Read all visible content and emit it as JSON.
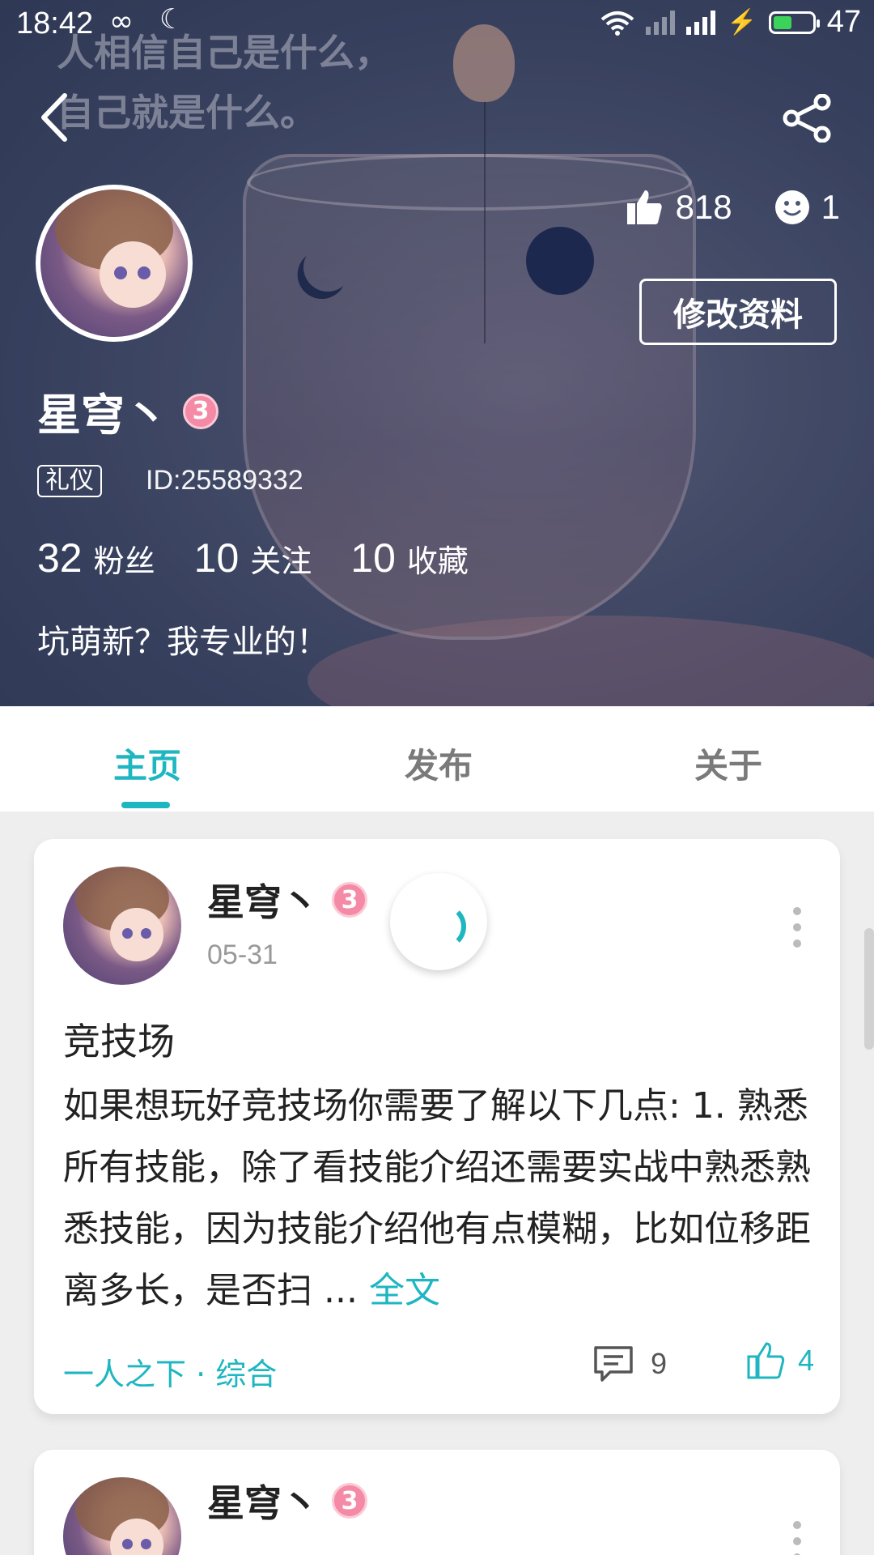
{
  "status_bar": {
    "time": "18:42",
    "battery": "47",
    "battery_level": 0.47
  },
  "cover": {
    "quote_line1": "人相信自己是什么，",
    "quote_line2": "自己就是什么。",
    "likes": "818",
    "visitors": "1",
    "edit_button": "修改资料",
    "nickname": "星穹丶",
    "level": "3",
    "tag": "礼仪",
    "user_id": "ID:25589332",
    "followers_count": "32",
    "followers_label": "粉丝",
    "following_count": "10",
    "following_label": "关注",
    "favorites_count": "10",
    "favorites_label": "收藏",
    "bio": "坑萌新？我专业的！"
  },
  "tabs": {
    "home": "主页",
    "publish": "发布",
    "about": "关于",
    "active": "home"
  },
  "posts": [
    {
      "author": "星穹丶",
      "level": "3",
      "date": "05-31",
      "title": "竞技场",
      "body": "如果想玩好竞技场你需要了解以下几点: 1. 熟悉所有技能，除了看技能介绍还需要实战中熟悉熟悉技能，因为技能介绍他有点模糊，比如位移距离多长，是否扫 ...",
      "full_text_link": "全文",
      "category": "一人之下 · 综合",
      "comments": "9",
      "likes": "4"
    },
    {
      "author": "星穹丶",
      "level": "3"
    }
  ],
  "colors": {
    "accent": "#1eb6c0",
    "level_badge": "#f48aa5"
  },
  "icons": [
    "back-icon",
    "share-icon",
    "thumb-up-icon",
    "smiley-icon",
    "comment-icon",
    "more-icon",
    "loading-spinner"
  ]
}
